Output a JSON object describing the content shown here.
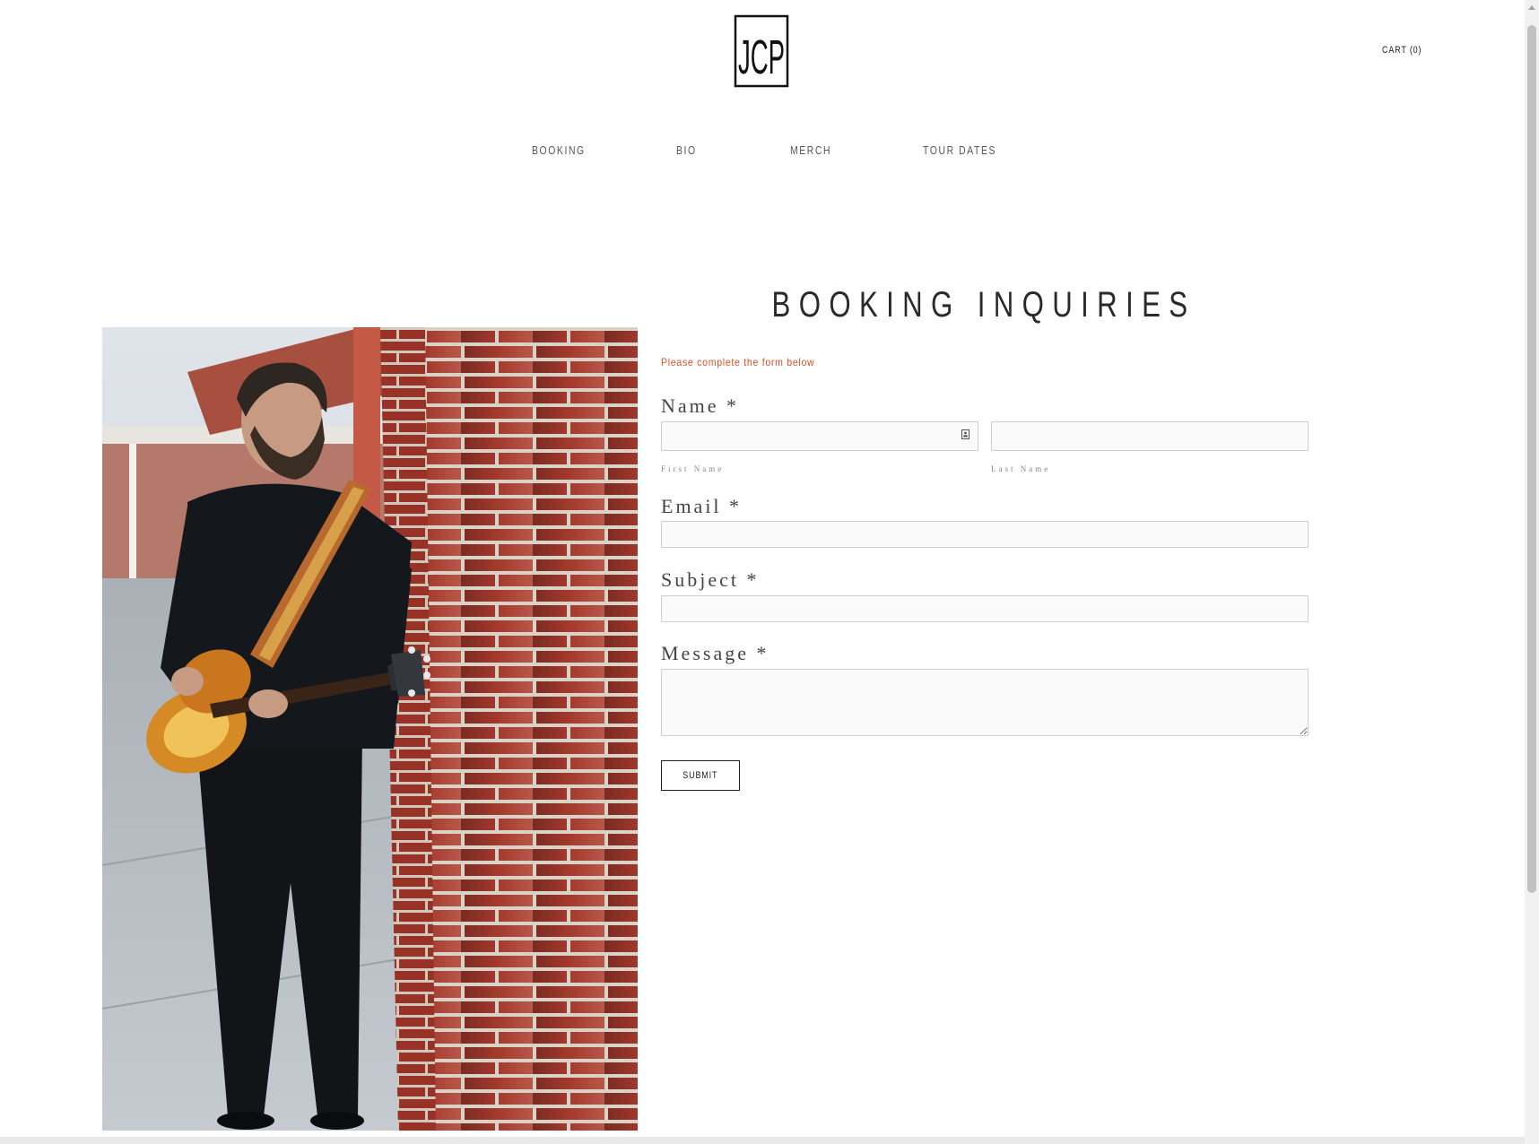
{
  "header": {
    "logo_text": "JCP",
    "cart_label": "CART (0)"
  },
  "nav": {
    "items": [
      {
        "label": "BOOKING"
      },
      {
        "label": "BIO"
      },
      {
        "label": "MERCH"
      },
      {
        "label": "TOUR DATES"
      }
    ]
  },
  "form": {
    "title": "BOOKING INQUIRIES",
    "instruction": "Please complete the form below",
    "name_label": "Name *",
    "first_name_sublabel": "First Name",
    "last_name_sublabel": "Last Name",
    "first_name_value": "",
    "last_name_value": "",
    "email_label": "Email *",
    "email_value": "",
    "subject_label": "Subject *",
    "subject_value": "",
    "message_label": "Message *",
    "message_value": "",
    "submit_label": "SUBMIT"
  },
  "colors": {
    "accent": "#e0502a",
    "text": "#2a2a2a",
    "border": "#cfcfcf"
  },
  "icons": {
    "autofill": "contact-card-icon"
  }
}
